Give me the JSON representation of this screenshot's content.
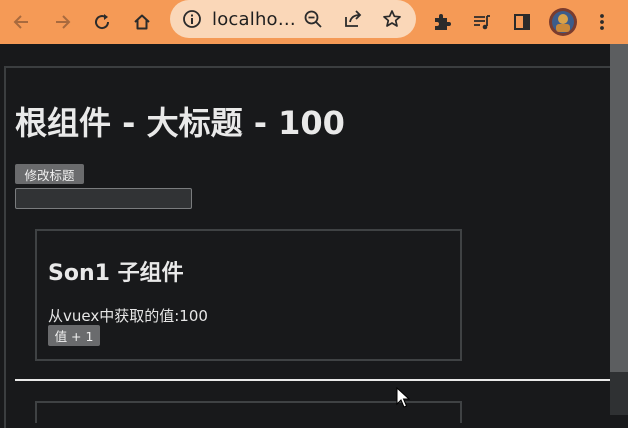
{
  "browser": {
    "url_text": "localho…"
  },
  "colors": {
    "toolbar": "#f59a56",
    "omnibox": "#fad7b8",
    "page_bg": "#18191b",
    "text": "#e9e9e9",
    "button_bg": "#6a6b6d"
  },
  "icons": {
    "back": "back-arrow-icon",
    "forward": "forward-arrow-icon",
    "reload": "reload-icon",
    "home": "home-icon",
    "site_info": "site-info-icon",
    "zoom": "zoom-icon",
    "share": "share-icon",
    "bookmark": "star-icon",
    "extensions": "puzzle-icon",
    "media": "media-queue-icon",
    "side_panel": "side-panel-icon",
    "profile": "avatar",
    "menu": "kebab-menu-icon"
  },
  "page": {
    "title": "根组件 - 大标题 - 100",
    "change_title_button": "修改标题",
    "title_input_value": "",
    "son1": {
      "title": "Son1 子组件",
      "text": "从vuex中获取的值:100",
      "increment_button": "值 + 1"
    }
  }
}
